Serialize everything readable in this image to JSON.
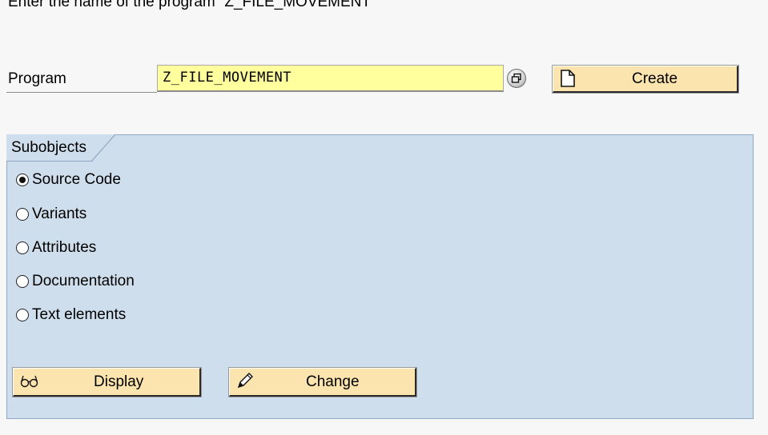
{
  "instruction": "Enter the name of the program “Z_FILE_MOVEMENT”",
  "program": {
    "label": "Program",
    "value": "Z_FILE_MOVEMENT",
    "input_color": "#ffff9e"
  },
  "buttons": {
    "create": "Create",
    "display": "Display",
    "change": "Change",
    "button_color": "#fbe4ad"
  },
  "subobjects": {
    "title": "Subobjects",
    "panel_color": "#cfdeec",
    "options": [
      {
        "label": "Source Code",
        "checked": true
      },
      {
        "label": "Variants",
        "checked": false
      },
      {
        "label": "Attributes",
        "checked": false
      },
      {
        "label": "Documentation",
        "checked": false
      },
      {
        "label": "Text elements",
        "checked": false
      }
    ]
  }
}
